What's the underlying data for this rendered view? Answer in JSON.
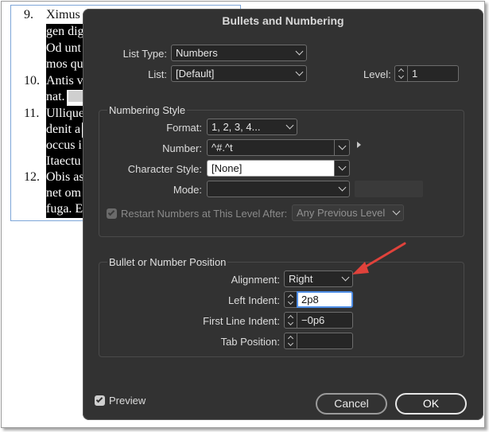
{
  "document": {
    "items": [
      {
        "num": "9.",
        "lines": [
          "Ximus",
          "gen dig",
          "Od unt",
          "mos qu"
        ]
      },
      {
        "num": "10.",
        "lines": [
          "Antis v",
          "nat."
        ]
      },
      {
        "num": "11.",
        "lines": [
          "Ullique",
          "denit a",
          "occus i",
          "Itaectu"
        ]
      },
      {
        "num": "12.",
        "lines": [
          "Obis as",
          "net om",
          "fuga. E"
        ]
      }
    ]
  },
  "dialog": {
    "title": "Bullets and Numbering",
    "list_type": {
      "label": "List Type:",
      "value": "Numbers"
    },
    "list": {
      "label": "List:",
      "value": "[Default]"
    },
    "level": {
      "label": "Level:",
      "value": "1"
    },
    "numbering_style": {
      "title": "Numbering Style",
      "format": {
        "label": "Format:",
        "value": "1, 2, 3, 4..."
      },
      "number": {
        "label": "Number:",
        "value": "^#.^t"
      },
      "character_style": {
        "label": "Character Style:",
        "value": "[None]"
      },
      "mode": {
        "label": "Mode:",
        "value": ""
      },
      "restart": {
        "label": "Restart Numbers at This Level After:",
        "value": "Any Previous Level",
        "checked": true,
        "enabled": false
      }
    },
    "position": {
      "title": "Bullet or Number Position",
      "alignment": {
        "label": "Alignment:",
        "value": "Right"
      },
      "left_indent": {
        "label": "Left Indent:",
        "value": "2p8"
      },
      "first_line_indent": {
        "label": "First Line Indent:",
        "value": "−0p6"
      },
      "tab_position": {
        "label": "Tab Position:",
        "value": ""
      }
    },
    "preview": {
      "label": "Preview",
      "checked": true
    },
    "cancel_label": "Cancel",
    "ok_label": "OK"
  },
  "colors": {
    "dialog_bg": "#323232",
    "annotation_arrow": "#e0423b",
    "focus_ring": "#4f8ee6"
  }
}
